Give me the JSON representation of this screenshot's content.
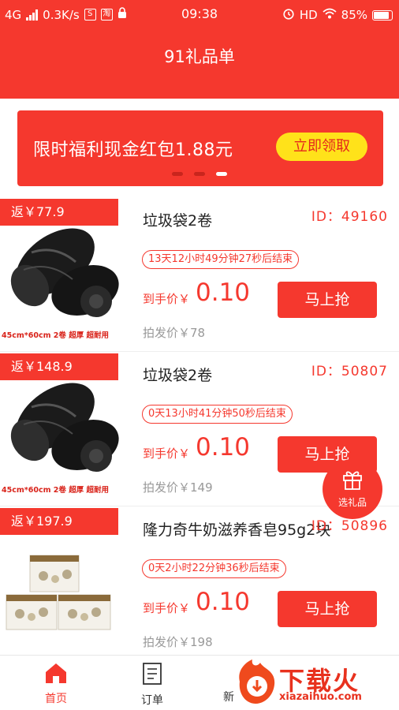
{
  "status_bar": {
    "network": "4G",
    "speed": "0.3K/s",
    "app_icon_1": "S",
    "app_icon_2": "淘",
    "time": "09:38",
    "hd": "HD",
    "battery": "85%"
  },
  "header": {
    "title": "91礼品单"
  },
  "banner": {
    "text": "限时福利现金红包1.88元",
    "button": "立即领取",
    "slide_count": 3,
    "active_slide": 3
  },
  "products": [
    {
      "rebate": "返￥77.9",
      "name": "垃圾袋2卷",
      "id": "ID：49160",
      "countdown": "13天12小时49分钟27秒后结束",
      "price_label": "到手价￥",
      "price": "0.10",
      "buy": "马上抢",
      "orig": "拍发价￥78",
      "img_caption": "45cm*60cm 2卷 超厚 超耐用"
    },
    {
      "rebate": "返￥148.9",
      "name": "垃圾袋2卷",
      "id": "ID：50807",
      "countdown": "0天13小时41分钟50秒后结束",
      "price_label": "到手价￥",
      "price": "0.10",
      "buy": "马上抢",
      "orig": "拍发价￥149",
      "img_caption": "45cm*60cm 2卷 超厚 超耐用"
    },
    {
      "rebate": "返￥197.9",
      "name": "隆力奇牛奶滋养香皂95g2块",
      "id": "ID：50896",
      "countdown": "0天2小时22分钟36秒后结束",
      "price_label": "到手价￥",
      "price": "0.10",
      "buy": "马上抢",
      "orig": "拍发价￥198"
    }
  ],
  "fab": {
    "label": "选礼品"
  },
  "tabbar": {
    "home": "首页",
    "orders": "订单",
    "new": "新"
  },
  "watermark": {
    "text": "下载火",
    "sub": "xiazaihuo.com"
  },
  "colors": {
    "brand": "#f5382e",
    "button_yellow": "#ffe21a"
  }
}
